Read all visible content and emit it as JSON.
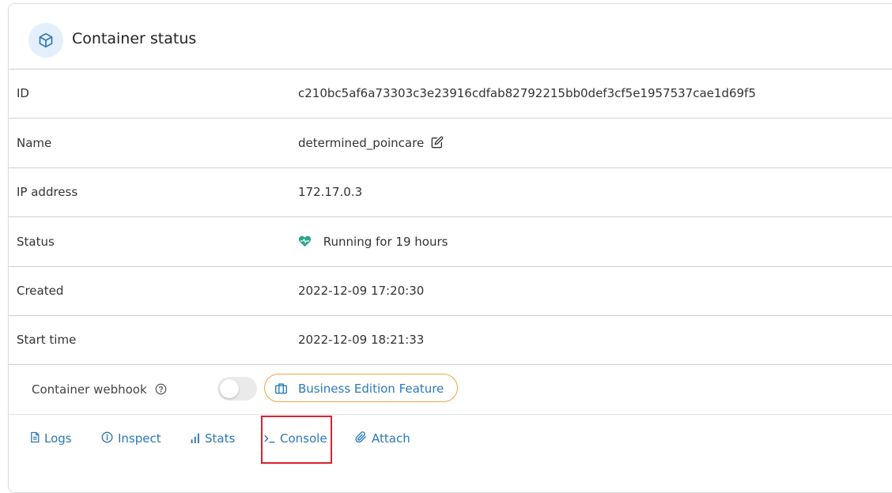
{
  "header": {
    "title": "Container status",
    "icon": "cube-icon",
    "icon_bg": "#e3f0fb",
    "icon_color": "#2b77b8"
  },
  "details": {
    "id": {
      "label": "ID",
      "value": "c210bc5af6a73303c3e23916cdfab82792215bb0def3cf5e1957537cae1d69f5"
    },
    "name": {
      "label": "Name",
      "value": "determined_poincare",
      "edit_icon": "edit-icon"
    },
    "ip": {
      "label": "IP address",
      "value": "172.17.0.3"
    },
    "status": {
      "label": "Status",
      "value": "Running for 19 hours",
      "icon": "heartbeat-icon",
      "color": "#2aa58a"
    },
    "created": {
      "label": "Created",
      "value": "2022-12-09 17:20:30"
    },
    "start_time": {
      "label": "Start time",
      "value": "2022-12-09 18:21:33"
    }
  },
  "webhook": {
    "label": "Container webhook",
    "help_icon": "help-circle-icon",
    "toggle_enabled": false,
    "badge_label": "Business Edition Feature",
    "badge_icon": "briefcase-icon",
    "badge_border_color": "#f0a443"
  },
  "actions": [
    {
      "label": "Logs",
      "icon": "file-text-icon"
    },
    {
      "label": "Inspect",
      "icon": "info-circle-icon"
    },
    {
      "label": "Stats",
      "icon": "bar-chart-icon"
    },
    {
      "label": "Console",
      "icon": "terminal-icon",
      "highlighted": true
    },
    {
      "label": "Attach",
      "icon": "paperclip-icon"
    }
  ],
  "colors": {
    "link": "#2b77b8",
    "highlight": "#d9232e"
  }
}
